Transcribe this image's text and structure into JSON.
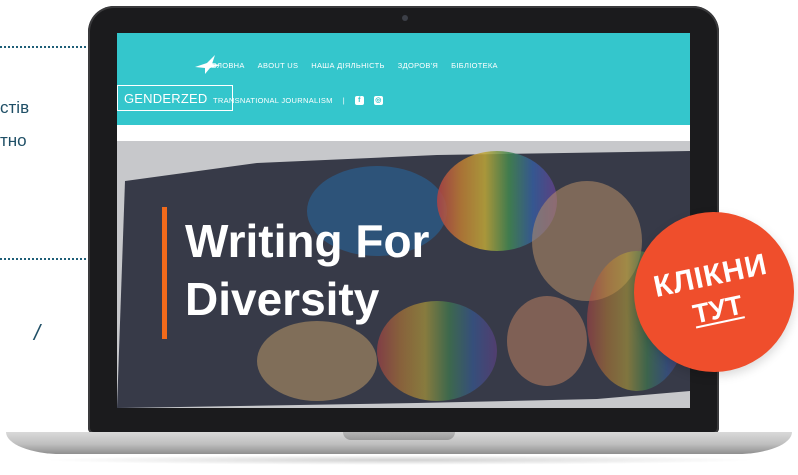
{
  "left_fragments": {
    "line1": "стів",
    "line2": "тно",
    "slash": "/"
  },
  "website": {
    "logo": "GENDERZED",
    "nav_primary": [
      "ГОЛОВНА",
      "ABOUT US",
      "НАША ДІЯЛЬНІСТЬ",
      "ЗДОРОВ'Я",
      "БІБЛІОТЕКА"
    ],
    "nav_secondary": "TRANSNATIONAL JOURNALISM",
    "separator": "|",
    "social_icons": [
      "facebook-icon",
      "instagram-icon"
    ],
    "accent_color": "#34c6cc"
  },
  "hero": {
    "title_line1": "Writing For",
    "title_line2": "Diversity",
    "accent_color": "#f26a1b"
  },
  "cta": {
    "line1": "КЛІКНИ",
    "line2": "ТУТ",
    "color": "#ef4e2c"
  }
}
